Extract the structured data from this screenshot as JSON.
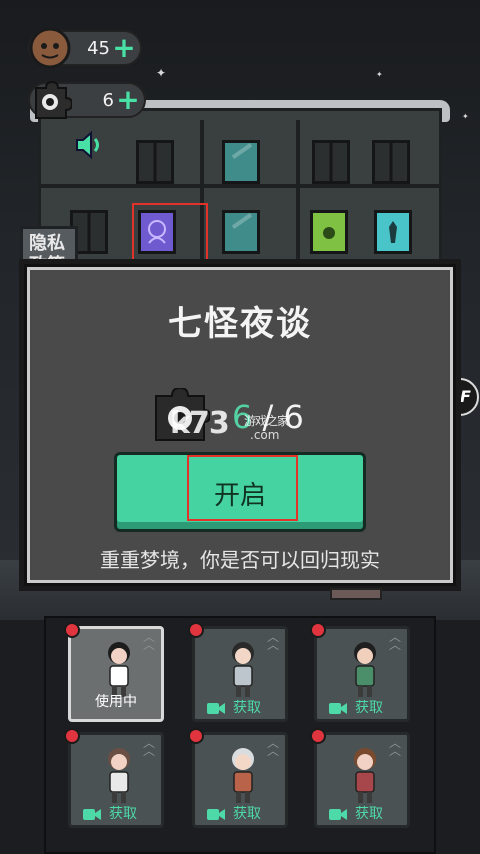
{
  "resources": {
    "coins": {
      "value": "45",
      "icon": "coin-face-icon"
    },
    "puzzle": {
      "value": "6",
      "icon": "puzzle-piece-icon"
    }
  },
  "scene": {
    "privacy_tag": "隐私\n政策",
    "ff_label": "FF"
  },
  "dialog": {
    "title": "七怪夜谈",
    "progress_current": "6",
    "progress_sep": "/",
    "progress_total": "6",
    "start_label": "开启",
    "subtitle": "重重梦境，你是否可以回归现实"
  },
  "watermark": {
    "brand": "k73",
    "site": "游戏之家",
    "domain": ".com"
  },
  "characters": [
    {
      "status": "使用中",
      "active": true,
      "hair": "#1c1c1c",
      "shirt": "#ffffff",
      "skin": "#f1d2c4"
    },
    {
      "status": "获取",
      "active": false,
      "hair": "#2a2a2a",
      "shirt": "#bcc6cc",
      "skin": "#f2d6c6"
    },
    {
      "status": "获取",
      "active": false,
      "hair": "#1f1f1f",
      "shirt": "#4a8f6a",
      "skin": "#f0cfbd"
    },
    {
      "status": "获取",
      "active": false,
      "hair": "#6a5044",
      "shirt": "#e9e9e9",
      "skin": "#f1d2c4"
    },
    {
      "status": "获取",
      "active": false,
      "hair": "#d9dde0",
      "shirt": "#b9644a",
      "skin": "#f3d8c7"
    },
    {
      "status": "获取",
      "active": false,
      "hair": "#7a4a2e",
      "shirt": "#a8474b",
      "skin": "#f1d2c4"
    }
  ],
  "colors": {
    "accent_green": "#45d3a2",
    "highlight_red": "#e2332b",
    "dot_red": "#e0343f"
  }
}
